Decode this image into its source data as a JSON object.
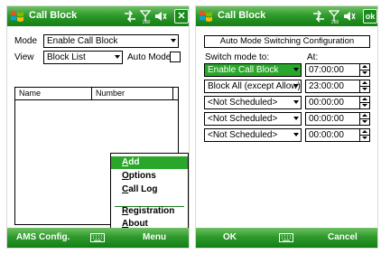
{
  "left": {
    "title": "Call Block",
    "signal_sub": "260",
    "close_label": "✕",
    "mode_label": "Mode",
    "mode_value": "Enable Call Block",
    "view_label": "View",
    "view_value": "Block List",
    "auto_mode_label": "Auto Mode",
    "columns": [
      "Name",
      "Number"
    ],
    "menu": [
      {
        "label": "Add",
        "mnemonic": "A",
        "rest": "dd"
      },
      {
        "label": "Options",
        "mnemonic": "O",
        "rest": "ptions"
      },
      {
        "label": "Call Log",
        "mnemonic": "C",
        "rest": "all Log"
      },
      {
        "label": "Registration",
        "mnemonic": "R",
        "rest": "egistration"
      },
      {
        "label": "About",
        "mnemonic": "A",
        "rest": "bout"
      }
    ],
    "softkey_left": "AMS Config.",
    "softkey_right": "Menu"
  },
  "right": {
    "title": "Call Block",
    "signal_sub": "260",
    "ok_label": "ok",
    "group_title": "Auto Mode Switching Configuration",
    "switch_label": "Switch mode to:",
    "at_label": "At:",
    "rows": [
      {
        "mode": "Enable Call Block",
        "time": "07:00:00"
      },
      {
        "mode": "Block All (except Allow)",
        "time": "23:00:00"
      },
      {
        "mode": "<Not Scheduled>",
        "time": "00:00:00"
      },
      {
        "mode": "<Not Scheduled>",
        "time": "00:00:00"
      },
      {
        "mode": "<Not Scheduled>",
        "time": "00:00:00"
      }
    ],
    "softkey_left": "OK",
    "softkey_right": "Cancel"
  },
  "colors": {
    "accent": "#2aa62a",
    "bar_dark": "#127f14",
    "bar_light": "#6fc165"
  },
  "icons": [
    "windows-start-icon",
    "connectivity-icon",
    "signal-icon",
    "volume-icon",
    "keyboard-icon"
  ]
}
